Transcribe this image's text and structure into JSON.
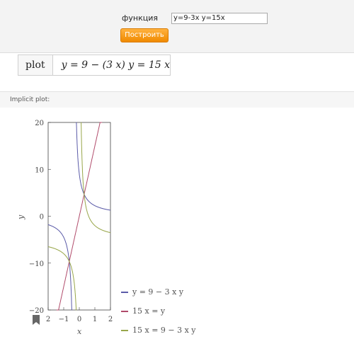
{
  "form": {
    "func_label": "функция",
    "func_value": "y=9-3x  y=15x",
    "build_button": "Построить"
  },
  "input_interpretation": {
    "head": "plot",
    "expression": "y = 9 − (3 x) y = 15 x"
  },
  "section": {
    "title": "Implicit plot:"
  },
  "chart_data": {
    "type": "line",
    "title": "",
    "xlabel": "x",
    "ylabel": "y",
    "xlim": [
      -2,
      2
    ],
    "ylim": [
      -20,
      20
    ],
    "x_ticks": [
      "2",
      "−1",
      "0",
      "1",
      "2"
    ],
    "y_ticks": [
      "−20",
      "−10",
      "0",
      "10",
      "20"
    ],
    "legend_position": "right",
    "series": [
      {
        "name": "y = 9 − 3 x y",
        "color": "#5b5ba8",
        "formula": "y = 9/(1+3x)"
      },
      {
        "name": "15 x = y",
        "color": "#b04a6a",
        "formula": "y = 15x"
      },
      {
        "name": "15 x = 9 − 3 x y",
        "color": "#98a64a",
        "formula": "y = (9-15x)/(3x)"
      }
    ]
  }
}
